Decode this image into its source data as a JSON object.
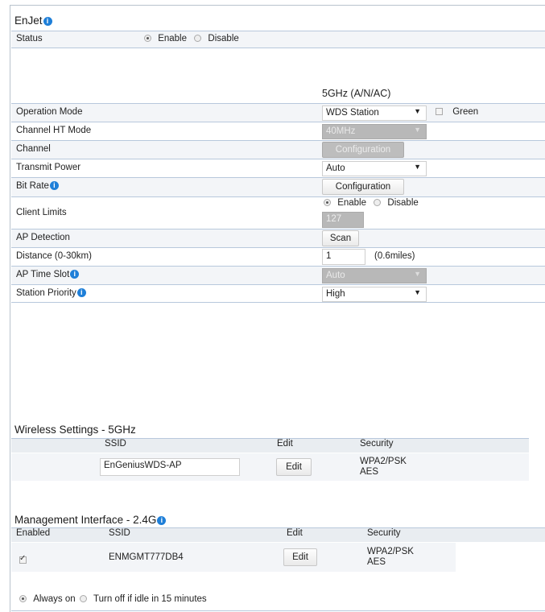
{
  "enjet": {
    "title": "EnJet",
    "status_label": "Status",
    "status_enable": "Enable",
    "status_disable": "Disable"
  },
  "column_header": "5GHz (A/N/AC)",
  "rows": {
    "operation_mode": {
      "label": "Operation Mode",
      "value": "WDS Station",
      "green_label": "Green"
    },
    "channel_ht_mode": {
      "label": "Channel HT Mode",
      "value": "40MHz"
    },
    "channel": {
      "label": "Channel",
      "button": "Configuration"
    },
    "transmit_power": {
      "label": "Transmit Power",
      "value": "Auto"
    },
    "bit_rate": {
      "label": "Bit Rate",
      "button": "Configuration"
    },
    "client_limits": {
      "label": "Client Limits",
      "enable": "Enable",
      "disable": "Disable",
      "value": "127"
    },
    "ap_detection": {
      "label": "AP Detection",
      "button": "Scan"
    },
    "distance": {
      "label": "Distance (0-30km)",
      "value": "1",
      "unit": "(0.6miles)"
    },
    "ap_time_slot": {
      "label": "AP Time Slot",
      "value": "Auto"
    },
    "station_priority": {
      "label": "Station Priority",
      "value": "High"
    }
  },
  "wireless": {
    "title": "Wireless Settings - 5GHz",
    "col_ssid": "SSID",
    "col_edit": "Edit",
    "col_security": "Security",
    "ssid_value": "EnGeniusWDS-AP",
    "edit_button": "Edit",
    "security_line1": "WPA2/PSK",
    "security_line2": "AES"
  },
  "management": {
    "title": "Management Interface - 2.4G",
    "col_enabled": "Enabled",
    "col_ssid": "SSID",
    "col_edit": "Edit",
    "col_security": "Security",
    "ssid_value": "ENMGMT777DB4",
    "edit_button": "Edit",
    "security_line1": "WPA2/PSK",
    "security_line2": "AES",
    "always_on": "Always on",
    "turn_off": "Turn off if idle in 15 minutes"
  }
}
